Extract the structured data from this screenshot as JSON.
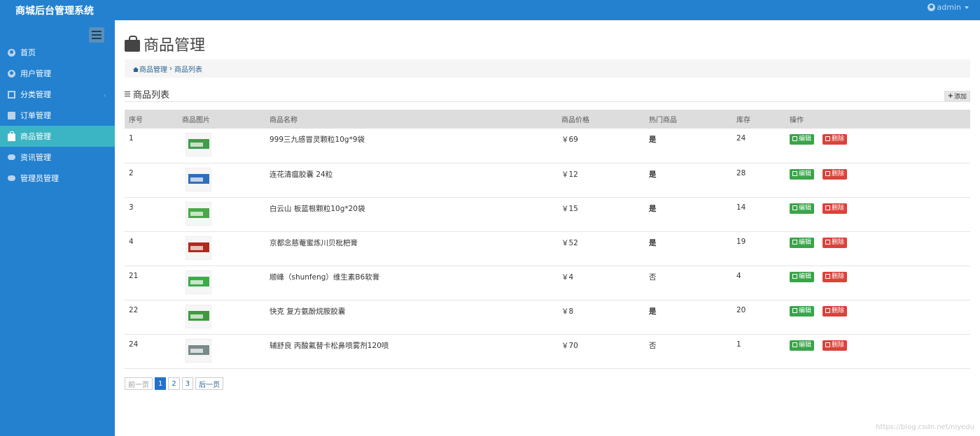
{
  "app": {
    "title": "商城后台管理系统",
    "user": "admin"
  },
  "sidebar": {
    "items": [
      {
        "label": "首页",
        "icon": "user-icon"
      },
      {
        "label": "用户管理",
        "icon": "user-icon"
      },
      {
        "label": "分类管理",
        "icon": "grid-icon",
        "chevron": "‹"
      },
      {
        "label": "订单管理",
        "icon": "document-icon"
      },
      {
        "label": "商品管理",
        "icon": "bag-icon",
        "active": true
      },
      {
        "label": "资讯管理",
        "icon": "chat-icon"
      },
      {
        "label": "管理员管理",
        "icon": "chat-icon"
      }
    ]
  },
  "page": {
    "title": "商品管理",
    "breadcrumb": [
      "商品管理",
      "商品列表"
    ],
    "breadcrumb_sep": "›",
    "section_title": "商品列表",
    "add_label": "添加"
  },
  "table": {
    "headers": [
      "序号",
      "商品图片",
      "商品名称",
      "商品价格",
      "热门商品",
      "库存",
      "操作"
    ],
    "edit_label": "编辑",
    "delete_label": "删除",
    "rows": [
      {
        "id": "1",
        "name": "999三九感冒灵颗粒10g*9袋",
        "price": "￥69",
        "hot": "是",
        "stock": "24",
        "thumb_color": "#3aa04a"
      },
      {
        "id": "2",
        "name": "连花清瘟胶囊 24粒",
        "price": "￥12",
        "hot": "是",
        "stock": "28",
        "thumb_color": "#2f6fb8"
      },
      {
        "id": "3",
        "name": "白云山 板蓝根颗粒10g*20袋",
        "price": "￥15",
        "hot": "是",
        "stock": "14",
        "thumb_color": "#4aa84a"
      },
      {
        "id": "4",
        "name": "京都念慈菴蜜炼川贝枇杷膏",
        "price": "￥52",
        "hot": "是",
        "stock": "19",
        "thumb_color": "#b02a20"
      },
      {
        "id": "21",
        "name": "顺峰（shunfeng）维生素B6软膏",
        "price": "￥4",
        "hot": "否",
        "stock": "4",
        "thumb_color": "#3cab4a"
      },
      {
        "id": "22",
        "name": "快克 复方氨酚烷胺胶囊",
        "price": "￥8",
        "hot": "是",
        "stock": "20",
        "thumb_color": "#3e9a3e"
      },
      {
        "id": "24",
        "name": "辅舒良 丙酸氟替卡松鼻喷雾剂120喷",
        "price": "￥70",
        "hot": "否",
        "stock": "1",
        "thumb_color": "#7a8a8a"
      }
    ]
  },
  "pagination": {
    "prev": "前一页",
    "pages": [
      "1",
      "2",
      "3"
    ],
    "current": "1",
    "next": "后一页"
  },
  "watermark": "https://blog.csdn.net/niyedu",
  "colors": {
    "header_blue": "#2381d0",
    "active_teal": "#3bb5c3",
    "edit_green": "#3aa44a",
    "delete_red": "#d9433b",
    "hot_red": "#e02020"
  }
}
